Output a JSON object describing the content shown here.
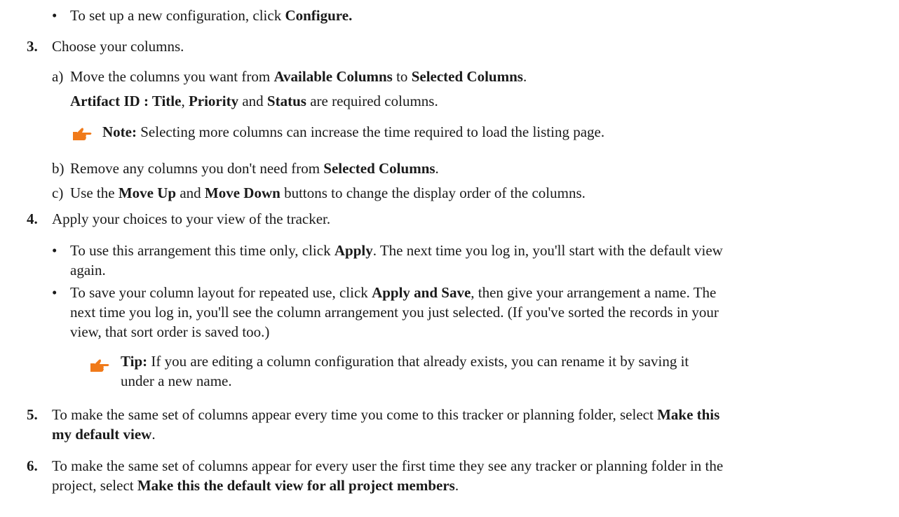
{
  "bullet_glyph": "•",
  "top_bullet": {
    "text": "To set up a new configuration, click ",
    "bold": "Configure."
  },
  "step3": {
    "num": "3.",
    "text": "Choose your columns.",
    "a": {
      "label": "a)",
      "t1": "Move the columns you want from ",
      "b1": "Available Columns",
      "t2": " to ",
      "b2": "Selected Columns",
      "t3": "."
    },
    "required": {
      "b1": "Artifact ID : Title",
      "t1": ", ",
      "b2": "Priority",
      "t2": " and ",
      "b3": "Status",
      "t3": " are required columns."
    },
    "note": {
      "icon": "pointing-hand-icon",
      "label": "Note:",
      "text": "  Selecting more columns can increase the time required to load the listing page."
    },
    "b": {
      "label": "b)",
      "t1": "Remove any columns you don't need from ",
      "b1": "Selected Columns",
      "t2": "."
    },
    "c": {
      "label": "c)",
      "t1": "Use the ",
      "b1": "Move Up",
      "t2": " and ",
      "b2": "Move Down",
      "t3": " buttons to change the display order of the columns."
    }
  },
  "step4": {
    "num": "4.",
    "text": "Apply your choices to your view of the tracker.",
    "bullet1": {
      "t1": "To use this arrangement this time only, click ",
      "b1": "Apply",
      "t2": ". The next time you log in, you'll start with the default view",
      "line2": "again."
    },
    "bullet2": {
      "t1": "To save your column layout for repeated use, click ",
      "b1": "Apply and Save",
      "t2": ", then give your arrangement a name. The",
      "line2": "next time you log in, you'll see the column arrangement you just selected. (If you've sorted the records in your",
      "line3": "view, that sort order is saved too.)"
    },
    "tip": {
      "icon": "pointing-hand-icon",
      "label": "Tip:",
      "line1": "  If you are editing a column configuration that already exists, you can rename it by saving it",
      "line2": "under a new name."
    }
  },
  "step5": {
    "num": "5.",
    "t1": "To make the same set of columns appear every time you come to this tracker or planning folder, select ",
    "b1": "Make this",
    "b2": "my default view",
    "t2": "."
  },
  "step6": {
    "num": "6.",
    "t1": "To make the same set of columns appear for every user the first time they see any tracker or planning folder in the",
    "t2": "project, select ",
    "b1": "Make this the default view for all project members",
    "t3": "."
  },
  "colors": {
    "text": "#1a1a1a",
    "icon": "#f07a1a"
  }
}
